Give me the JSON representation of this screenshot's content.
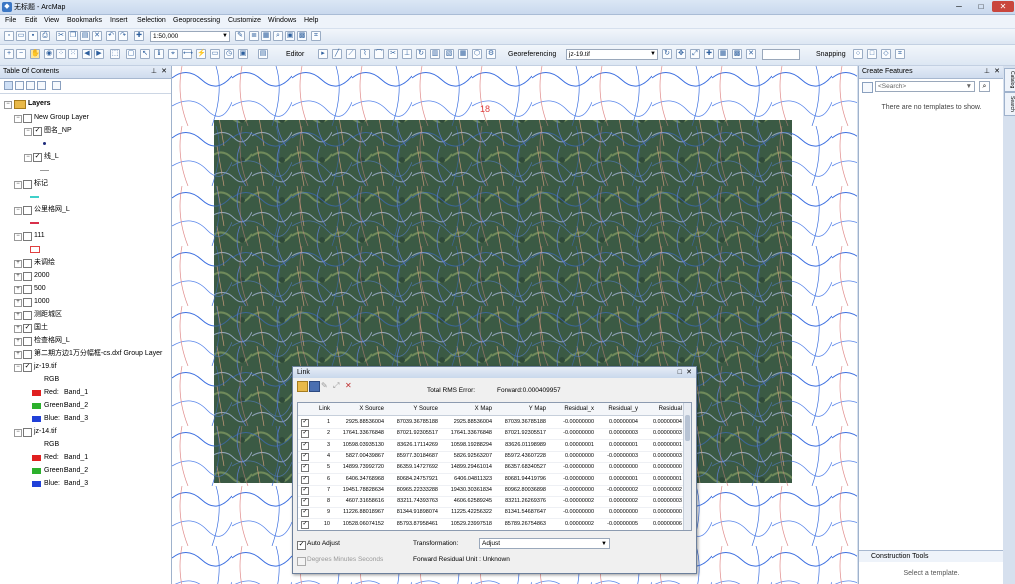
{
  "title_bar": {
    "title": "无标题 - ArcMap",
    "minimize": "─",
    "maximize": "□",
    "close": "✕"
  },
  "menu": [
    "File",
    "Edit",
    "View",
    "Bookmarks",
    "Insert",
    "Selection",
    "Geoprocessing",
    "Customize",
    "Windows",
    "Help"
  ],
  "toolbar": {
    "scale": "1:50,000",
    "editor_label": "Editor",
    "georef_label": "Georeferencing",
    "georef_layer": "jz-19.tif",
    "snapping_label": "Snapping"
  },
  "toc": {
    "title": "Table Of Contents",
    "layers_root": "Layers",
    "items": [
      {
        "label": "New Group Layer",
        "checked": false
      },
      {
        "label": "图名_NP",
        "checked": true
      },
      {
        "label": "线_L",
        "checked": true
      },
      {
        "label": "标记",
        "checked": false
      },
      {
        "label": "公里格网_L",
        "checked": false
      },
      {
        "label": "111",
        "checked": false
      },
      {
        "label": "未调绘",
        "checked": false
      },
      {
        "label": "2000",
        "checked": false
      },
      {
        "label": "500",
        "checked": false
      },
      {
        "label": "1000",
        "checked": false
      },
      {
        "label": "测距城区",
        "checked": false
      },
      {
        "label": "国土",
        "checked": true
      },
      {
        "label": "检查格网_L",
        "checked": false
      },
      {
        "label": "第二期方边1万分幅框-cs.dxf Group Layer",
        "checked": false
      },
      {
        "label": "jz-19.tif",
        "checked": true
      },
      {
        "label": "jz-14.tif",
        "checked": false
      }
    ],
    "rgb_label": "RGB",
    "bands": [
      {
        "channel": "Red:",
        "band": "Band_1",
        "color": "#e02020"
      },
      {
        "channel": "Green:",
        "band": "Band_2",
        "color": "#2cb02c"
      },
      {
        "channel": "Blue:",
        "band": "Band_3",
        "color": "#2040d8"
      }
    ]
  },
  "create_features": {
    "title": "Create Features",
    "search_placeholder": "<Search>",
    "empty_msg": "There are no templates to show.",
    "construction_title": "Construction Tools",
    "construction_msg": "Select a template."
  },
  "side_tabs": [
    "Catalog",
    "Search"
  ],
  "map_label": "18",
  "link_dialog": {
    "title": "Link",
    "total_rms_label": "Total RMS Error:",
    "total_rms_value": "Forward:0.000409957",
    "columns": [
      "Link",
      "X Source",
      "Y Source",
      "X Map",
      "Y Map",
      "Residual_x",
      "Residual_y",
      "Residual"
    ],
    "rows": [
      [
        "1",
        "2925.88536004",
        "87039.36785188",
        "2925.88536004",
        "87039.36785188",
        "-0.00000000",
        "0.00000004",
        "0.00000004"
      ],
      [
        "2",
        "17641.33676848",
        "87021.92305517",
        "17641.33676848",
        "87021.92305517",
        "-0.00000000",
        "0.00000003",
        "0.00000003"
      ],
      [
        "3",
        "10598.03935130",
        "83626.17114269",
        "10598.19288294",
        "83626.01198989",
        "0.00000001",
        "0.00000001",
        "0.00000001"
      ],
      [
        "4",
        "5827.00439867",
        "85977.30184687",
        "5826.92563207",
        "85972.43607228",
        "0.00000000",
        "-0.00000003",
        "0.00000003"
      ],
      [
        "5",
        "14899.73992720",
        "86359.14727692",
        "14899.29461014",
        "86357.68340527",
        "-0.00000000",
        "0.00000000",
        "0.00000000"
      ],
      [
        "6",
        "6406.34768968",
        "80684.24757921",
        "6406.04811323",
        "80681.94419796",
        "-0.00000000",
        "0.00000001",
        "0.00000001"
      ],
      [
        "7",
        "19451.78828634",
        "80965.22333288",
        "19430.30361834",
        "80962.80036898",
        "-0.00000000",
        "-0.00000002",
        "0.00000002"
      ],
      [
        "8",
        "4607.31658616",
        "83211.74393763",
        "4606.62589245",
        "83211.26269376",
        "-0.00000002",
        "0.00000002",
        "0.00000003"
      ],
      [
        "9",
        "11226.88018967",
        "81344.91898074",
        "11225.42256322",
        "81341.54687647",
        "-0.00000000",
        "0.00000000",
        "0.00000000"
      ],
      [
        "10",
        "10528.06074152",
        "85793.87958461",
        "10529.23997518",
        "85789.26754863",
        "0.00000002",
        "-0.00000005",
        "0.00000006"
      ]
    ],
    "auto_adjust_label": "Auto Adjust",
    "auto_adjust_checked": true,
    "transformation_label": "Transformation:",
    "transformation_value": "Adjust",
    "dms_label": "Degrees Minutes Seconds",
    "residual_unit": "Forward Residual Unit : Unknown"
  }
}
